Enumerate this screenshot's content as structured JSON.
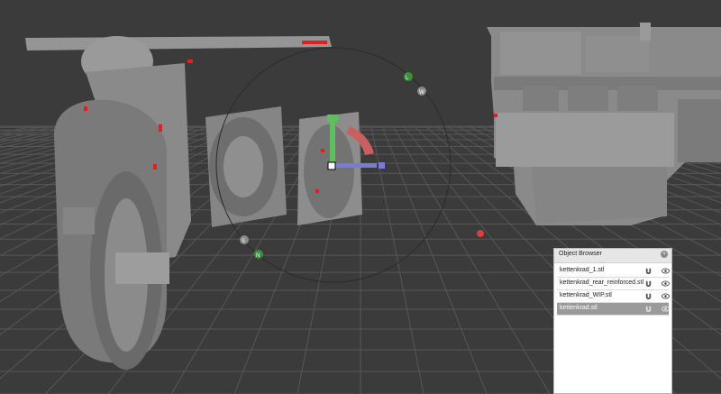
{
  "object_browser": {
    "title": "Object Browser",
    "items": [
      {
        "label": "kettenkrad_1.stl",
        "selected": false
      },
      {
        "label": "kettenkrad_rear_reinforced.stl",
        "selected": false
      },
      {
        "label": "kettenkrad_WIP.stl",
        "selected": false
      },
      {
        "label": "kettenkrad.stl",
        "selected": true
      }
    ]
  },
  "gizmo": {
    "label_l": "L",
    "label_w": "W",
    "label_s": "S",
    "label_n": "N"
  },
  "colors": {
    "background": "#3b3b3b",
    "grid": "#5a5a5a",
    "model": "#8d8d8d",
    "axis_y": "#5fbf5f",
    "axis_x": "#7b7bd6",
    "axis_z": "#c96060",
    "marker": "#e02020",
    "node_green": "#3d8f3d",
    "node_gray": "#8a8a8a"
  }
}
